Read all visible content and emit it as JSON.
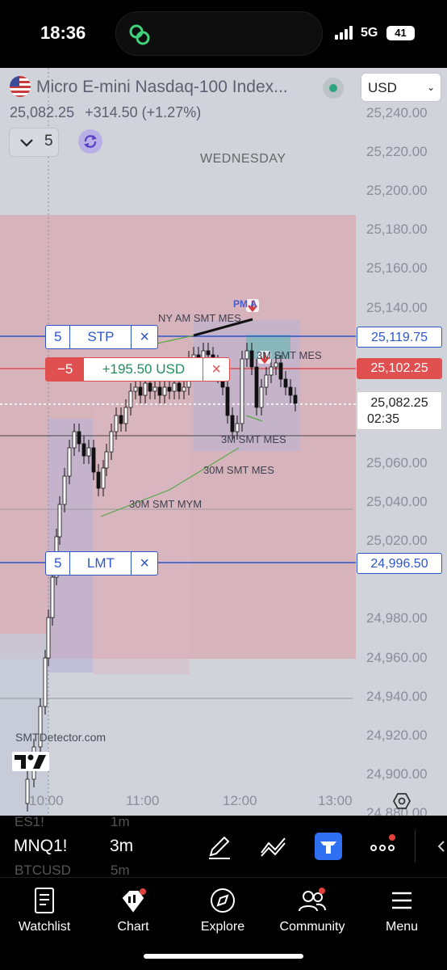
{
  "status": {
    "time": "18:36",
    "network": "5G",
    "battery": "41"
  },
  "header": {
    "symbol_name": "Micro E-mini Nasdaq-100 Index...",
    "currency": "USD",
    "price": "25,082.25",
    "change": "+314.50 (+1.27%)",
    "quantity": "5",
    "day": "WEDNESDAY"
  },
  "price_axis": [
    "25,240.00",
    "25,220.00",
    "25,200.00",
    "25,180.00",
    "25,160.00",
    "25,140.00",
    "25,060.00",
    "25,040.00",
    "25,020.00",
    "24,980.00",
    "24,960.00",
    "24,940.00",
    "24,920.00",
    "24,900.00",
    "24,880.00"
  ],
  "time_axis": [
    "10:00",
    "11:00",
    "12:00",
    "13:00"
  ],
  "orders": {
    "stop": {
      "qty": "5",
      "type": "STP",
      "price": "25,119.75"
    },
    "position": {
      "qty": "−5",
      "pnl": "+195.50 USD",
      "price": "25,102.25"
    },
    "limit": {
      "qty": "5",
      "type": "LMT",
      "price": "24,996.50"
    },
    "last": {
      "price": "25,082.25",
      "countdown": "02:35"
    },
    "close_glyph": "×"
  },
  "annotations": {
    "ny_am": "NY AM SMT MES",
    "pm_a": "PM A",
    "smt_mes_top": "3M SMT MES",
    "smt_mes_3m": "3M SMT MES",
    "smt_mes_30m": "30M SMT MES",
    "smt_mym_30m": "30M SMT MYM"
  },
  "watermark": "SMTDetector.com",
  "toolbar": {
    "symbol": "MNQ1!",
    "interval": "3m",
    "ghost_symbols": [
      "ES1!",
      "BTCUSD"
    ],
    "ghost_intervals": [
      "1m",
      "5m"
    ]
  },
  "nav": [
    "Watchlist",
    "Chart",
    "Explore",
    "Community",
    "Menu"
  ],
  "colors": {
    "chart_bg": "#d0d3da",
    "red_zone": "#d9a8b0",
    "blue_order": "#2f56c8",
    "red_order": "#e05050",
    "pnl_green": "#1e8f5a"
  }
}
